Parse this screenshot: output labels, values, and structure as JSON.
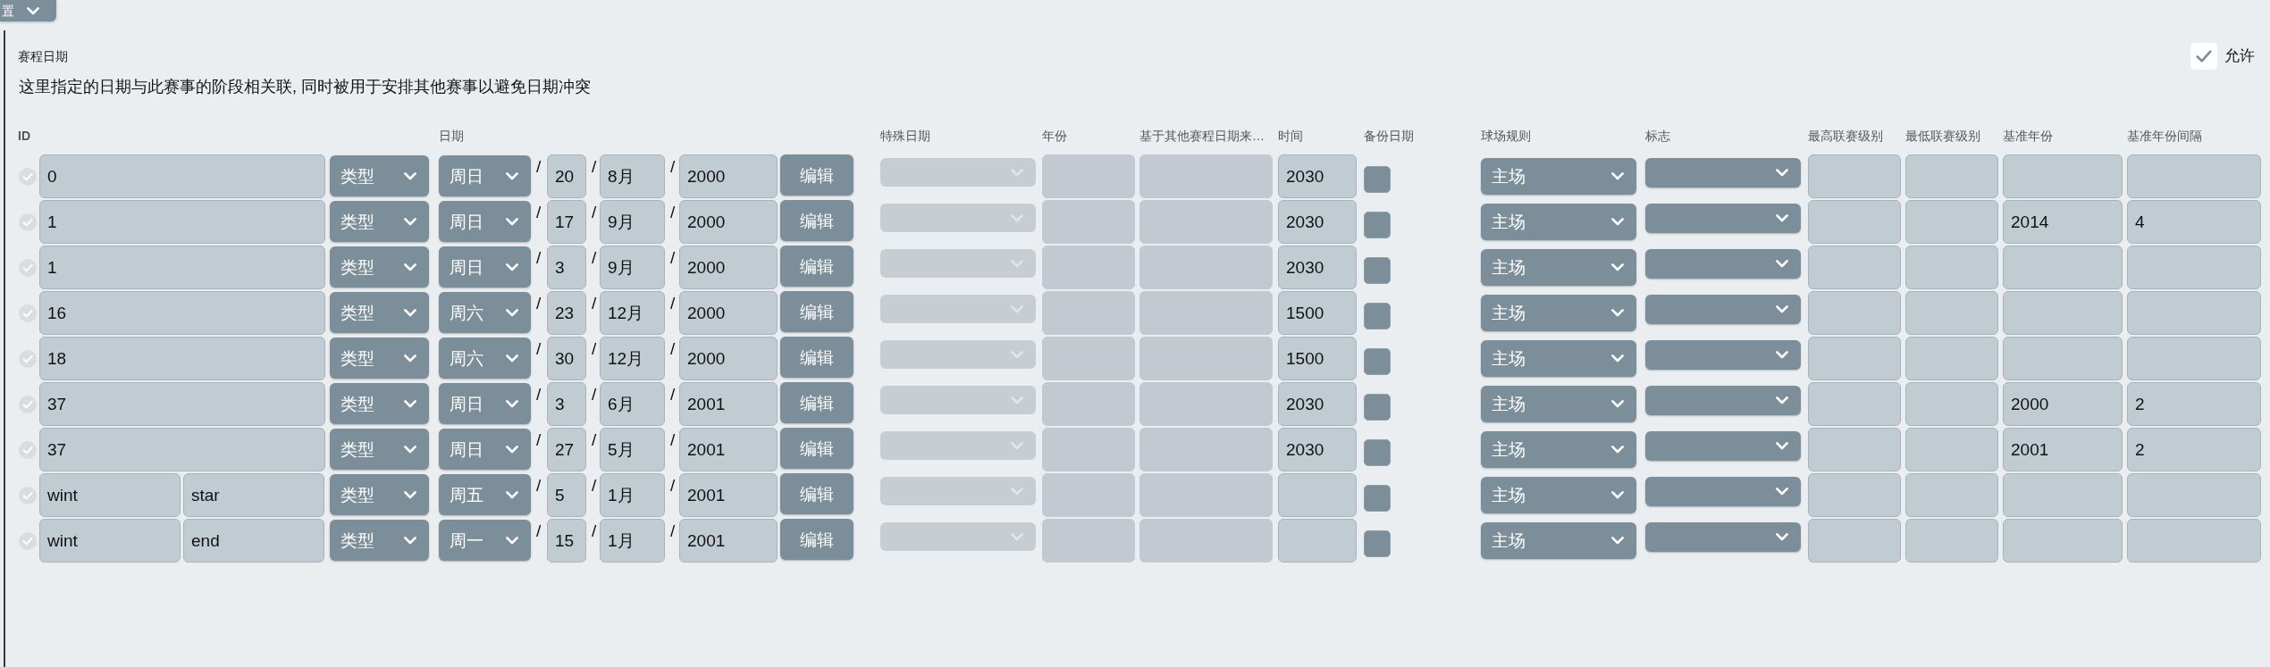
{
  "top_button": {
    "label": "置"
  },
  "section": {
    "title": "赛程日期",
    "allow": {
      "label": "允许",
      "checked": true
    },
    "description": "这里指定的日期与此赛事的阶段相关联, 同时被用于安排其他赛事以避免日期冲突"
  },
  "table": {
    "columns": [
      "ID",
      "日期",
      "特殊日期",
      "年份",
      "基于其他赛程日期来…",
      "时间",
      "备份日期",
      "球场规则",
      "标志",
      "最高联赛级别",
      "最低联赛级别",
      "基准年份",
      "基准年份间隔"
    ],
    "rows": [
      {
        "id": [
          "0"
        ],
        "type": "类型",
        "weekday": "周日",
        "separators": [
          "/",
          "/",
          "/"
        ],
        "day": "20",
        "month": "8月",
        "year": "2000",
        "edit": "编辑",
        "special_date": {
          "disabled": true
        },
        "time": "2030",
        "backup": false,
        "venue_rule": "主场"
      },
      {
        "id": [
          "1"
        ],
        "type": "类型",
        "weekday": "周日",
        "separators": [
          "/",
          "/",
          "/"
        ],
        "day": "17",
        "month": "9月",
        "year": "2000",
        "edit": "编辑",
        "special_date": {
          "disabled": true
        },
        "time": "2030",
        "backup": false,
        "venue_rule": "主场",
        "base_year": "2014",
        "base_year_interval": "4"
      },
      {
        "id": [
          "1"
        ],
        "type": "类型",
        "weekday": "周日",
        "separators": [
          "/",
          "/",
          "/"
        ],
        "day": "3",
        "month": "9月",
        "year": "2000",
        "edit": "编辑",
        "special_date": {
          "disabled": true
        },
        "time": "2030",
        "backup": false,
        "venue_rule": "主场"
      },
      {
        "id": [
          "16"
        ],
        "type": "类型",
        "weekday": "周六",
        "separators": [
          "/",
          "/",
          "/"
        ],
        "day": "23",
        "month": "12月",
        "year": "2000",
        "edit": "编辑",
        "special_date": {
          "disabled": true
        },
        "time": "1500",
        "backup": false,
        "venue_rule": "主场"
      },
      {
        "id": [
          "18"
        ],
        "type": "类型",
        "weekday": "周六",
        "separators": [
          "/",
          "/",
          "/"
        ],
        "day": "30",
        "month": "12月",
        "year": "2000",
        "edit": "编辑",
        "special_date": {
          "disabled": true
        },
        "time": "1500",
        "backup": false,
        "venue_rule": "主场"
      },
      {
        "id": [
          "37"
        ],
        "type": "类型",
        "weekday": "周日",
        "separators": [
          "/",
          "/",
          "/"
        ],
        "day": "3",
        "month": "6月",
        "year": "2001",
        "edit": "编辑",
        "special_date": {
          "disabled": true
        },
        "time": "2030",
        "backup": false,
        "venue_rule": "主场",
        "base_year": "2000",
        "base_year_interval": "2"
      },
      {
        "id": [
          "37"
        ],
        "type": "类型",
        "weekday": "周日",
        "separators": [
          "/",
          "/",
          "/"
        ],
        "day": "27",
        "month": "5月",
        "year": "2001",
        "edit": "编辑",
        "special_date": {
          "disabled": true
        },
        "time": "2030",
        "backup": false,
        "venue_rule": "主场",
        "base_year": "2001",
        "base_year_interval": "2"
      },
      {
        "id": [
          "wint",
          "star"
        ],
        "type": "类型",
        "weekday": "周五",
        "separators": [
          "/",
          "/",
          "/"
        ],
        "day": "5",
        "month": "1月",
        "year": "2001",
        "edit": "编辑",
        "special_date": {
          "disabled": true
        },
        "backup": false,
        "venue_rule": "主场"
      },
      {
        "id": [
          "wint",
          "end"
        ],
        "type": "类型",
        "weekday": "周一",
        "separators": [
          "/",
          "/",
          "/"
        ],
        "day": "15",
        "month": "1月",
        "year": "2001",
        "edit": "编辑",
        "special_date": {
          "disabled": true
        },
        "backup": false,
        "venue_rule": "主场"
      }
    ]
  }
}
